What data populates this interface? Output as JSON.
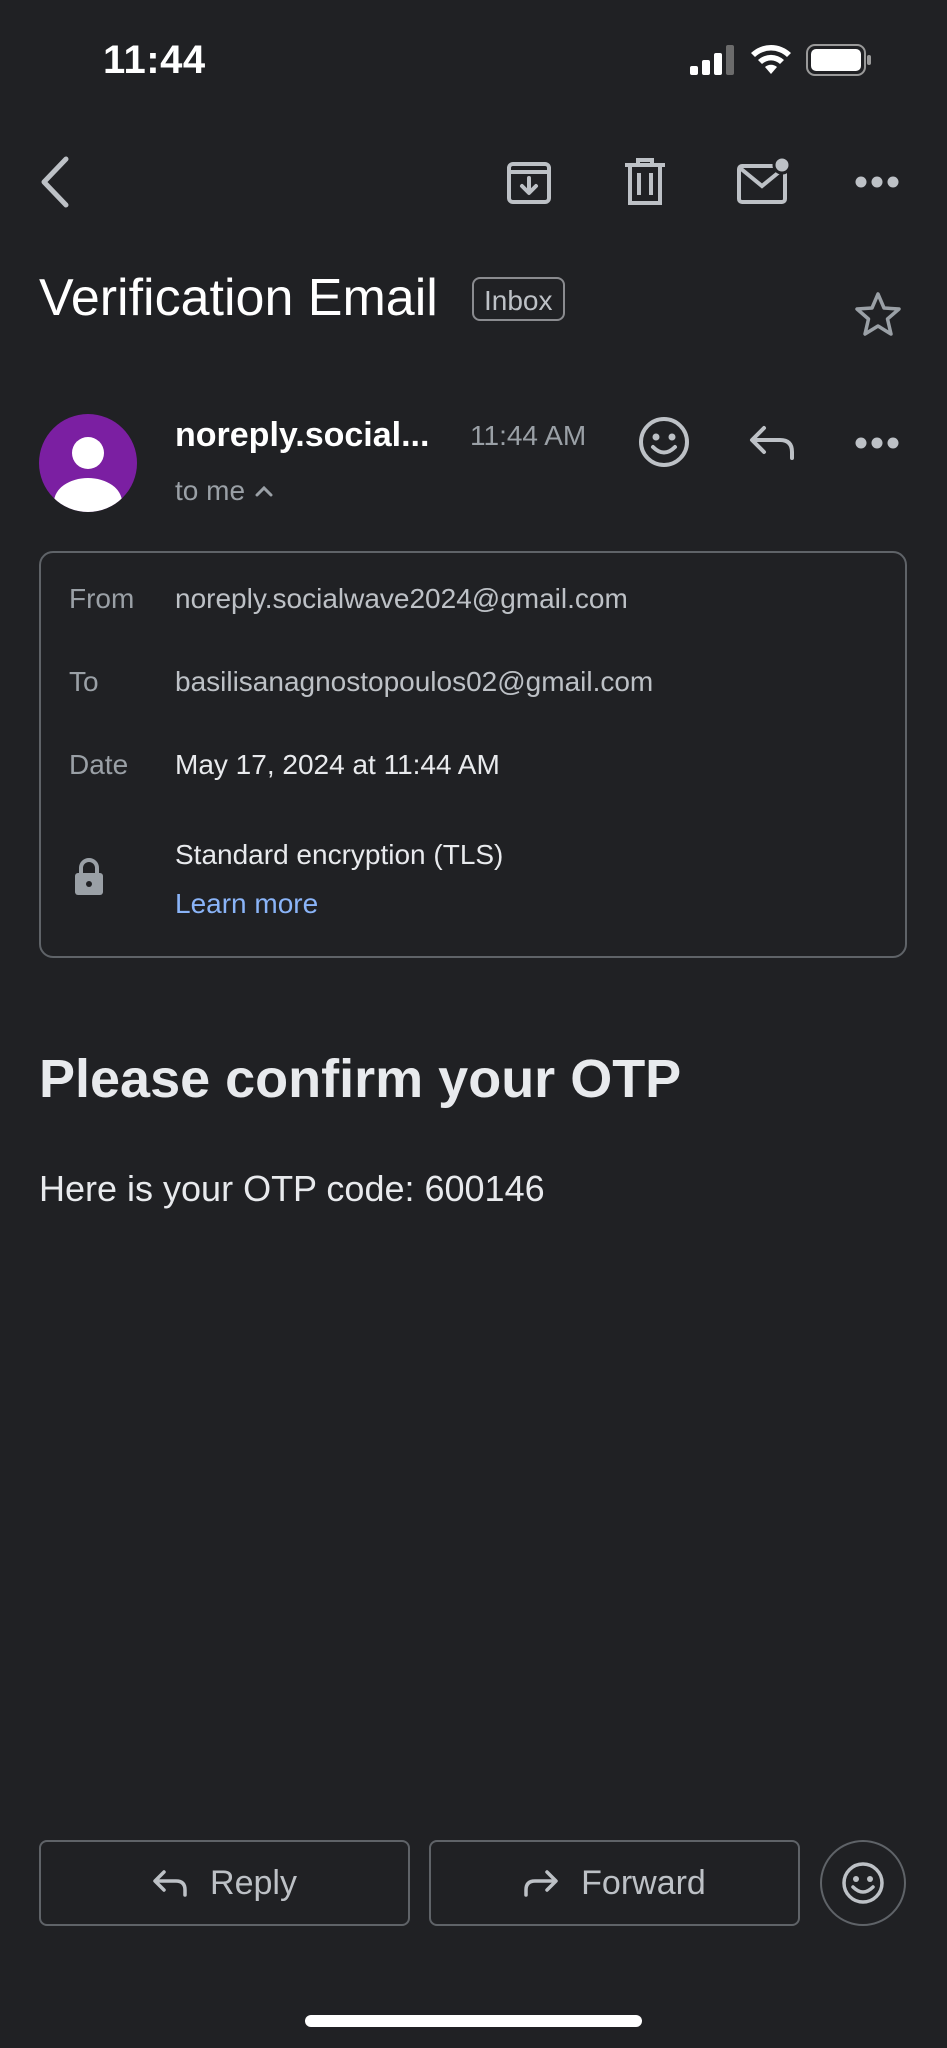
{
  "status_bar": {
    "time": "11:44",
    "icons": [
      "signal-icon",
      "wifi-icon",
      "battery-icon"
    ]
  },
  "toolbar": {
    "back_icon": "chevron-left-icon",
    "actions": [
      "archive-icon",
      "delete-icon",
      "mark-unread-icon",
      "more-icon"
    ]
  },
  "email": {
    "subject": "Verification Email",
    "label": "Inbox",
    "sender": {
      "name": "noreply.social...",
      "time": "11:44 AM",
      "recipient_summary": "to me",
      "avatar_color": "#7b1fa2"
    },
    "details": {
      "from_label": "From",
      "from_value": "noreply.socialwave2024@gmail.com",
      "to_label": "To",
      "to_value": "basilisanagnostopoulos02@gmail.com",
      "date_label": "Date",
      "date_value": "May 17, 2024 at 11:44 AM",
      "security_value": "Standard encryption (TLS)",
      "learn_more": "Learn more"
    },
    "headline": "Please confirm your OTP",
    "body": "Here is your OTP code: 600146"
  },
  "bottom_actions": {
    "reply": "Reply",
    "forward": "Forward"
  },
  "colors": {
    "background": "#202124",
    "link": "#8ab4f8",
    "border": "#5f6368"
  }
}
